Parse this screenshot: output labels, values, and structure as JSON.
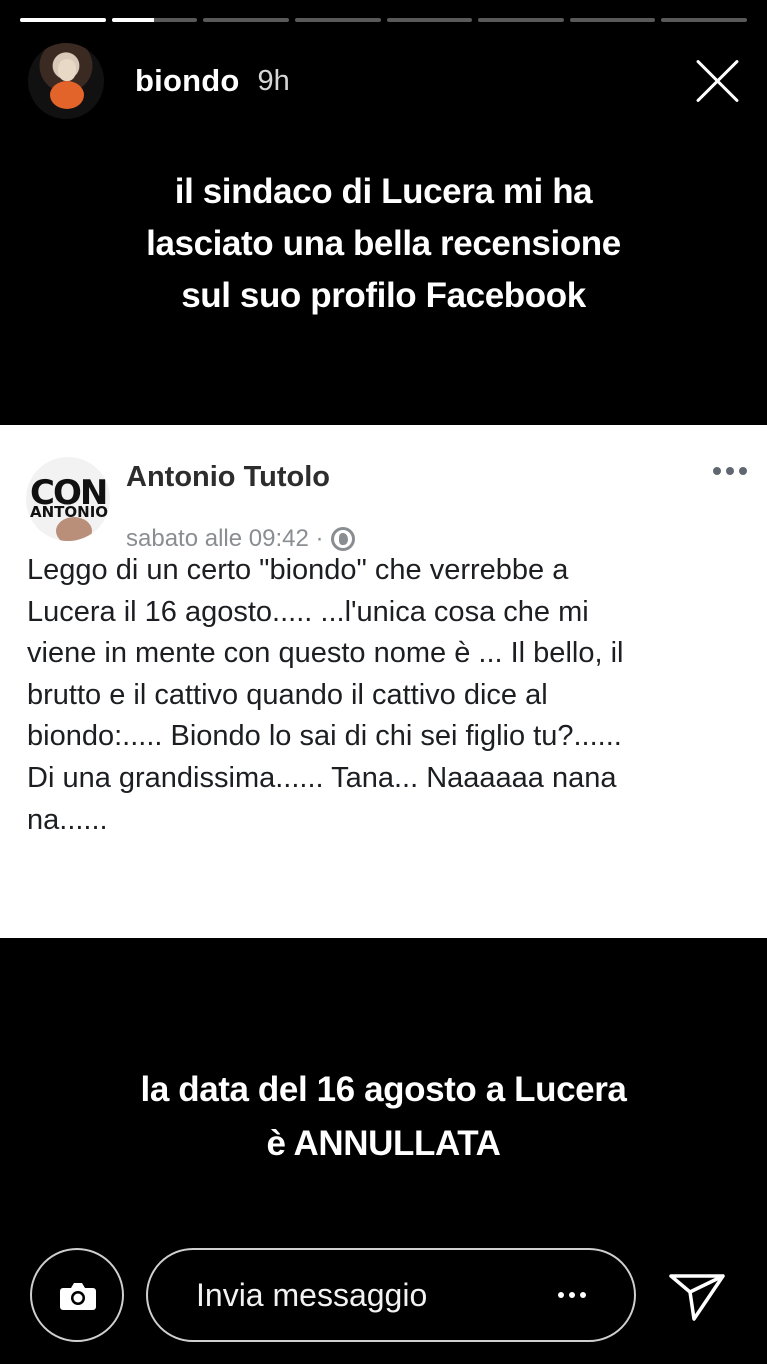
{
  "story": {
    "progress": [
      {
        "state": "seen",
        "fill": 1
      },
      {
        "state": "current",
        "fill": 0.5
      },
      {
        "state": "unseen",
        "fill": 0
      },
      {
        "state": "unseen",
        "fill": 0
      },
      {
        "state": "unseen",
        "fill": 0
      },
      {
        "state": "unseen",
        "fill": 0
      },
      {
        "state": "unseen",
        "fill": 0
      },
      {
        "state": "unseen",
        "fill": 0
      }
    ],
    "header": {
      "username": "biondo",
      "time": "9h",
      "close_icon": "close-icon"
    },
    "caption_top": "il sindaco di Lucera mi ha\nlasciato una bella recensione\nsul suo profilo Facebook",
    "caption_bottom": "la data del 16 agosto a Lucera\nè ANNULLATA"
  },
  "facebook_post": {
    "author": "Antonio Tutolo",
    "avatar_text_line1": "CON",
    "avatar_text_line2": "ANTONIO",
    "meta": "sabato alle 09:42 ·",
    "privacy_icon": "globe-icon",
    "more_icon": "more-horizontal-icon",
    "body": "Leggo di un certo \"biondo\" che verrebbe a\nLucera il 16 agosto..... ...l'unica cosa che mi\nviene in mente con questo nome è ... Il bello, il\nbrutto e il cattivo quando il cattivo dice al\nbiondo:..... Biondo lo sai di chi sei figlio tu?......\nDi una grandissima...... Tana... Naaaaaa nana\nna......"
  },
  "footer": {
    "camera_icon": "camera-icon",
    "message_placeholder": "Invia messaggio",
    "more_icon": "more-horizontal-icon",
    "send_icon": "send-icon"
  },
  "colors": {
    "background": "#000000",
    "card_background": "#ffffff",
    "meta_gray": "#8a8d91"
  }
}
